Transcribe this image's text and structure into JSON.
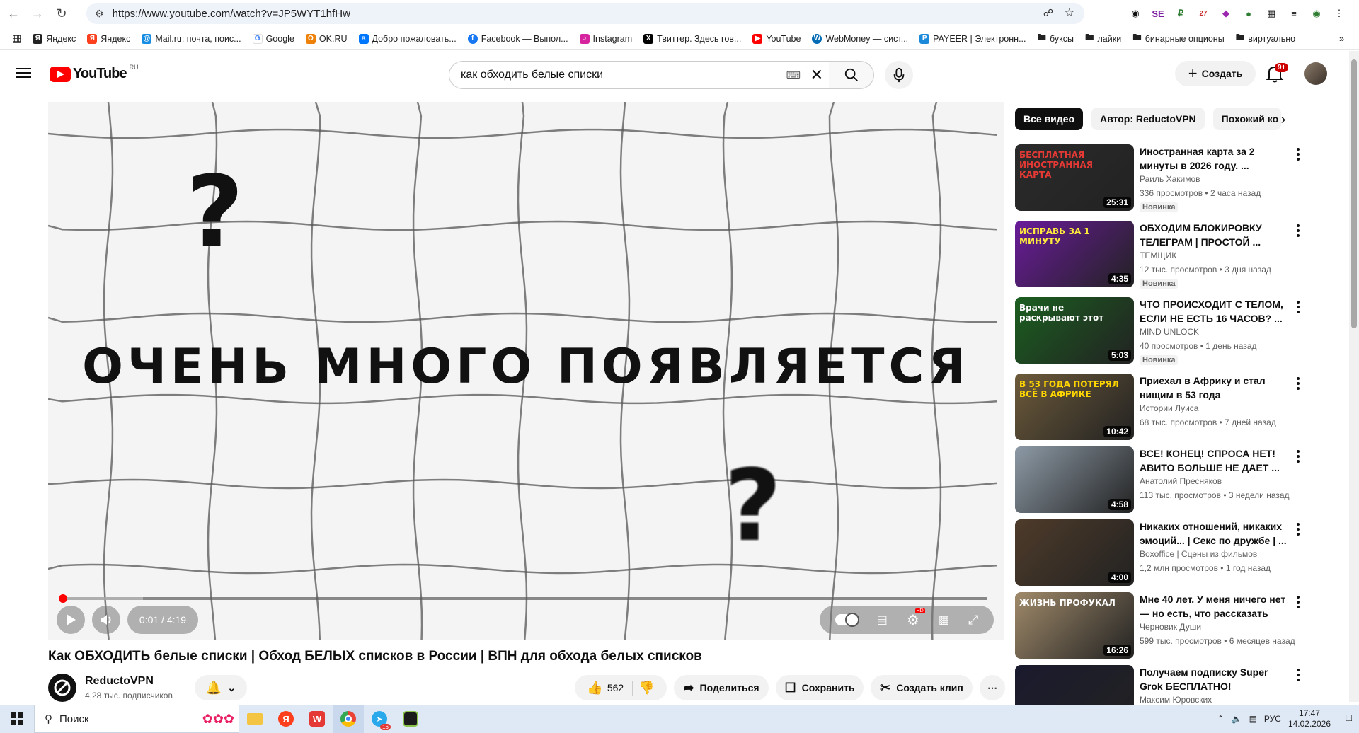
{
  "browser": {
    "url": "https://www.youtube.com/watch?v=JP5WYT1hfHw",
    "bookmarks": [
      {
        "label": "Яндекс",
        "color": "#222"
      },
      {
        "label": "Яндекс",
        "color": "#fc3f1d"
      },
      {
        "label": "Mail.ru: почта, поис...",
        "color": "#168de2"
      },
      {
        "label": "Google",
        "color": "#4285f4"
      },
      {
        "label": "OK.RU",
        "color": "#ee8208"
      },
      {
        "label": "Добро пожаловать...",
        "color": "#0077ff"
      },
      {
        "label": "Facebook — Выпол...",
        "color": "#1877f2"
      },
      {
        "label": "Instagram",
        "color": "#d6249f"
      },
      {
        "label": "Твиттер. Здесь гов...",
        "color": "#000"
      },
      {
        "label": "YouTube",
        "color": "#ff0000"
      },
      {
        "label": "WebMoney — сист...",
        "color": "#036cb5"
      },
      {
        "label": "PAYEER | Электронн...",
        "color": "#1c8adb"
      },
      {
        "label": "буксы",
        "color": "folder"
      },
      {
        "label": "лайки",
        "color": "folder"
      },
      {
        "label": "бинарные опционы",
        "color": "folder"
      },
      {
        "label": "виртуально",
        "color": "folder"
      }
    ]
  },
  "header": {
    "logo_word": "YouTube",
    "logo_region": "RU",
    "search_query": "как обходить белые списки",
    "create_label": "Создать",
    "notifications_badge": "9+"
  },
  "player": {
    "overlay_text": "ОЧЕНЬ МНОГО ПОЯВЛЯЕТСЯ",
    "question_mark": "?",
    "time": "0:01 / 4:19",
    "progress_fraction": 0.004,
    "loaded_fraction": 0.09
  },
  "video": {
    "title": "Как ОБХОДИТЬ белые списки | Обход БЕЛЫХ списков в России | ВПН для обхода белых списков",
    "channel": "ReductoVPN",
    "subscribers": "4,28 тыс. подписчиков",
    "likes": "562",
    "share_label": "Поделиться",
    "save_label": "Сохранить",
    "clip_label": "Создать клип"
  },
  "sidebar": {
    "chips": [
      "Все видео",
      "Автор: ReductoVPN",
      "Похожий ко"
    ],
    "recommendations": [
      {
        "title": "Иностранная карта за 2 минуты в 2026 году. ...",
        "channel": "Раиль Хакимов",
        "meta": "336 просмотров • 2 часа назад",
        "badge": "Новинка",
        "duration": "25:31",
        "thumb_text": "БЕСПЛАТНАЯ ИНОСТРАННАЯ КАРТА",
        "bg": "#2b2b2b",
        "accent": "#e53935"
      },
      {
        "title": "ОБХОДИМ БЛОКИРОВКУ ТЕЛЕГРАМ | ПРОСТОЙ ...",
        "channel": "ТЕМЩИК",
        "meta": "12 тыс. просмотров • 3 дня назад",
        "badge": "Новинка",
        "duration": "4:35",
        "thumb_text": "ИСПРАВЬ ЗА 1 МИНУТУ",
        "bg": "#6a1b9a",
        "accent": "#ffeb3b"
      },
      {
        "title": "ЧТО ПРОИСХОДИТ С ТЕЛОМ, ЕСЛИ НЕ ЕСТЬ 16 ЧАСОВ? ...",
        "channel": "MIND UNLOCK",
        "meta": "40 просмотров • 1 день назад",
        "badge": "Новинка",
        "duration": "5:03",
        "thumb_text": "Врачи не раскрывают этот",
        "bg": "#1b5e20",
        "accent": "#ffffff"
      },
      {
        "title": "Приехал в Африку и стал нищим в 53 года",
        "channel": "Истории Луиса",
        "meta": "68 тыс. просмотров • 7 дней назад",
        "badge": "",
        "duration": "10:42",
        "thumb_text": "В 53 ГОДА ПОТЕРЯЛ ВСЁ В АФРИКЕ",
        "bg": "#6d5a3a",
        "accent": "#ffd600"
      },
      {
        "title": "ВСЕ! КОНЕЦ! СПРОСА НЕТ! АВИТО БОЛЬШЕ НЕ ДАЕТ ...",
        "channel": "Анатолий Пресняков",
        "meta": "113 тыс. просмотров • 3 недели назад",
        "badge": "",
        "duration": "4:58",
        "thumb_text": "",
        "bg": "#8d9aa6",
        "accent": "#ffffff"
      },
      {
        "title": "Никаких отношений, никаких эмоций... | Секс по дружбе | ...",
        "channel": "Boxoffice | Сцены из фильмов",
        "meta": "1,2 млн просмотров • 1 год назад",
        "badge": "",
        "duration": "4:00",
        "thumb_text": "",
        "bg": "#4e3b2a",
        "accent": "#ffffff"
      },
      {
        "title": "Мне 40 лет. У меня ничего нет — но есть, что рассказать",
        "channel": "Черновик Души",
        "meta": "599 тыс. просмотров • 6 месяцев назад",
        "badge": "",
        "duration": "16:26",
        "thumb_text": "ЖИЗНЬ ПРОФУКАЛ",
        "bg": "#a08a6a",
        "accent": "#ffffff"
      },
      {
        "title": "Получаем подписку Super Grok БЕСПЛАТНО! Генерируе...",
        "channel": "Максим Юровских",
        "meta": "",
        "badge": "",
        "duration": "",
        "thumb_text": "",
        "bg": "#1a1a2e",
        "accent": "#e53935"
      }
    ]
  },
  "taskbar": {
    "search_label": "Поиск",
    "lang": "РУС",
    "time": "17:47",
    "date": "14.02.2026",
    "telegram_badge": "16"
  }
}
